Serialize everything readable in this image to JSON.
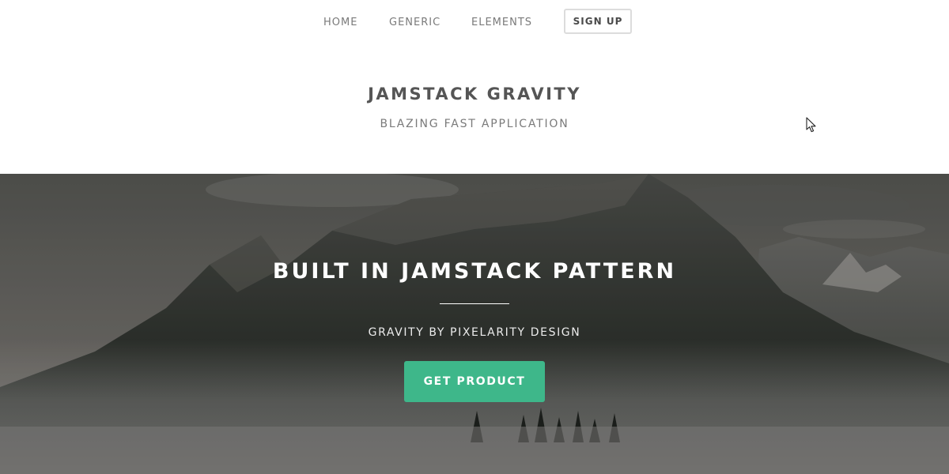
{
  "nav": {
    "home_label": "HOME",
    "generic_label": "GENERIC",
    "elements_label": "ELEMENTS",
    "signup_label": "SIGN UP"
  },
  "header": {
    "title": "JAMSTACK GRAVITY",
    "subtitle": "BLAZING FAST APPLICATION"
  },
  "hero": {
    "title": "BUILT IN JAMSTACK PATTERN",
    "subtitle": "GRAVITY BY PIXELARITY DESIGN",
    "cta_label": "GET PRODUCT"
  },
  "colors": {
    "accent": "#3eb78a",
    "text_primary": "#555555",
    "text_secondary": "#7a7a7a"
  },
  "icons": {
    "cursor": "mouse-pointer-icon"
  }
}
